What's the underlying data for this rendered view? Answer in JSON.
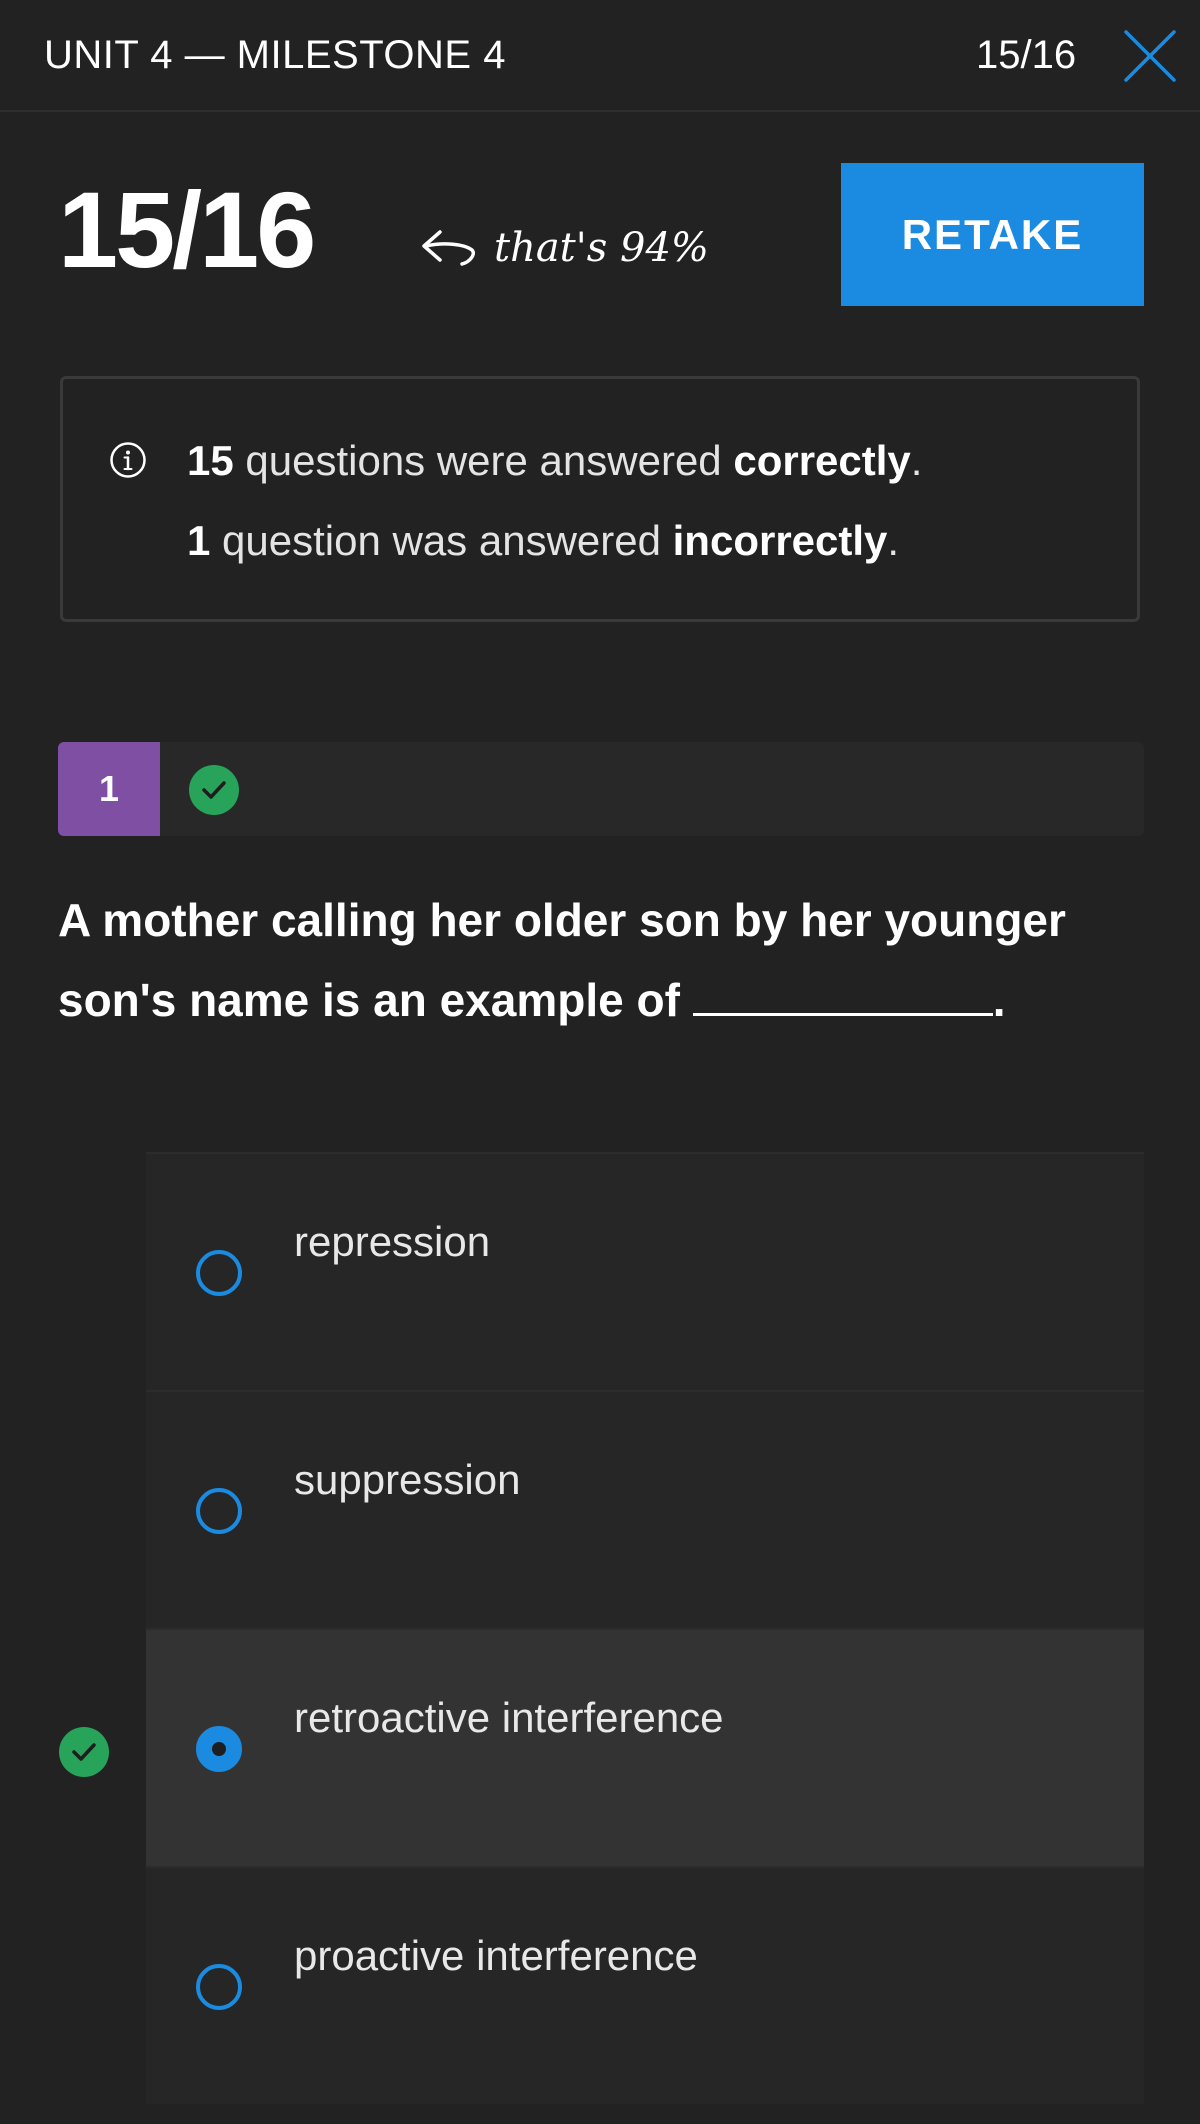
{
  "header": {
    "title": "UNIT 4 — MILESTONE 4",
    "progress": "15/16",
    "close_icon": "close-x-icon"
  },
  "score": {
    "value": "15/16",
    "percent_note": "that's 94%",
    "percent_icon": "curved-arrow-left-icon",
    "retake_label": "RETAKE"
  },
  "summary": {
    "icon": "info-icon",
    "correct_count": "15",
    "correct_text_mid": "questions were answered",
    "correct_word": "correctly",
    "incorrect_count": "1",
    "incorrect_text_mid": "question was answered",
    "incorrect_word": "incorrectly",
    "period": "."
  },
  "question": {
    "number": "1",
    "status_icon": "check-circle-icon",
    "text": "A mother calling her older son by her younger son's name is an example of",
    "suffix": "."
  },
  "options": [
    {
      "label": "repression",
      "selected": false
    },
    {
      "label": "suppression",
      "selected": false
    },
    {
      "label": "retroactive interference",
      "selected": true,
      "correct": true
    },
    {
      "label": "proactive interference",
      "selected": false
    }
  ],
  "colors": {
    "background": "#222222",
    "accent_blue": "#1a8be0",
    "question_number_purple": "#7e4fa3",
    "correct_green": "#27a35a"
  }
}
